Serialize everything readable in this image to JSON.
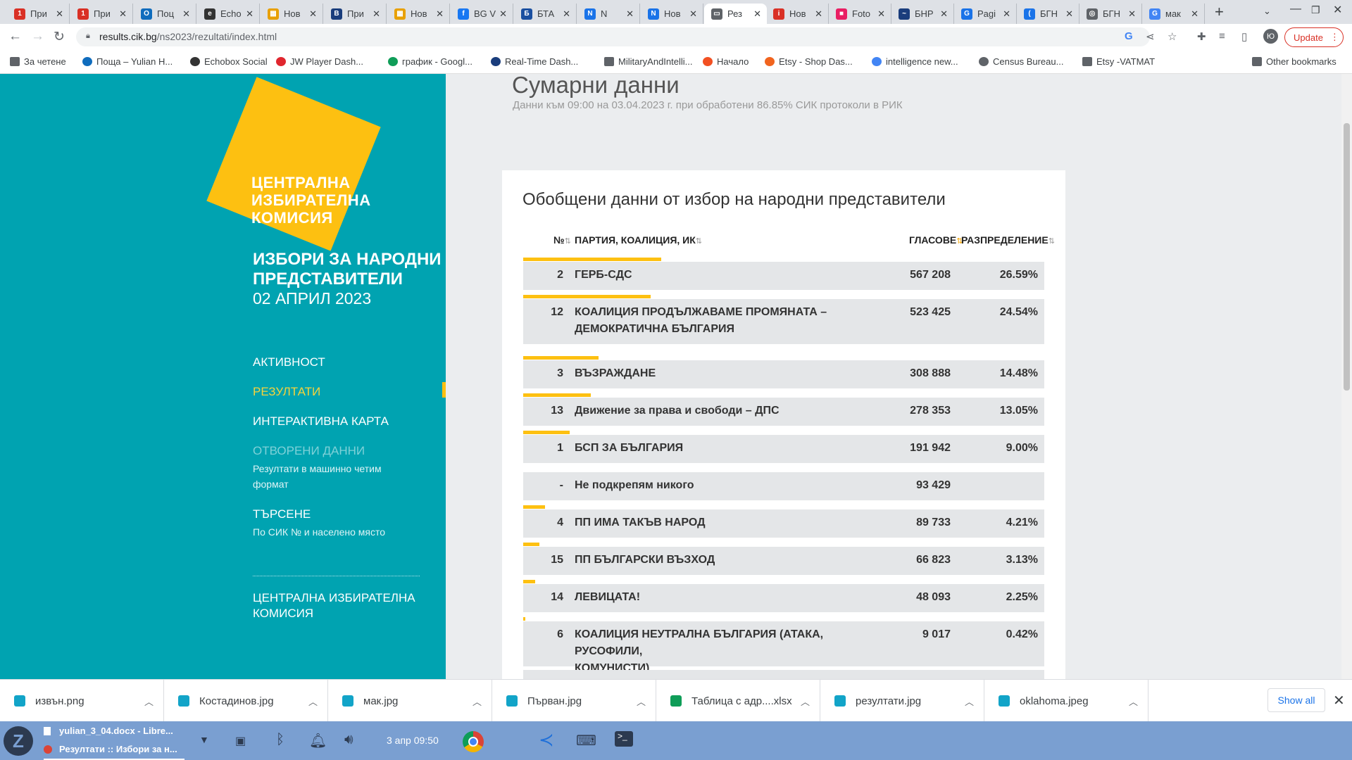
{
  "browser": {
    "tabs": [
      {
        "label": "При",
        "fav_color": "#d93025",
        "fav_char": "1"
      },
      {
        "label": "При",
        "fav_color": "#d93025",
        "fav_char": "1"
      },
      {
        "label": "Поц",
        "fav_color": "#0f6cbd",
        "fav_char": "O"
      },
      {
        "label": "Echo",
        "fav_color": "#333333",
        "fav_char": "e"
      },
      {
        "label": "Нов",
        "fav_color": "#e8a000",
        "fav_char": "▦"
      },
      {
        "label": "При",
        "fav_color": "#1a3d7c",
        "fav_char": "B"
      },
      {
        "label": "Нов",
        "fav_color": "#e8a000",
        "fav_char": "▦"
      },
      {
        "label": "BG V",
        "fav_color": "#1877f2",
        "fav_char": "f"
      },
      {
        "label": "БТА",
        "fav_color": "#1a4fa0",
        "fav_char": "Б"
      },
      {
        "label": "N",
        "fav_color": "#1a73e8",
        "fav_char": "N"
      },
      {
        "label": "Нов",
        "fav_color": "#1a73e8",
        "fav_char": "N"
      },
      {
        "label": "Рез",
        "fav_color": "#5f6368",
        "fav_char": "▭"
      },
      {
        "label": "Нов",
        "fav_color": "#d93025",
        "fav_char": "i"
      },
      {
        "label": "Foto",
        "fav_color": "#e91e63",
        "fav_char": "■"
      },
      {
        "label": "БНР",
        "fav_color": "#1a3d7c",
        "fav_char": "~"
      },
      {
        "label": "Pagi",
        "fav_color": "#1a73e8",
        "fav_char": "G"
      },
      {
        "label": "БГН",
        "fav_color": "#1a73e8",
        "fav_char": "("
      },
      {
        "label": "БГН",
        "fav_color": "#5f6368",
        "fav_char": "◎"
      },
      {
        "label": "мак",
        "fav_color": "#4285f4",
        "fav_char": "G"
      }
    ],
    "url_host": "results.cik.bg",
    "url_path": "/ns2023/rezultati/index.html",
    "update_label": "Update",
    "profile_initial": "Ю",
    "bookmarks": [
      {
        "label": "За четене",
        "icon": "folder-icon"
      },
      {
        "label": "Поща – Yulian H...",
        "icon": "outlook-icon"
      },
      {
        "label": "Echobox Social",
        "icon": "echobox-icon"
      },
      {
        "label": "JW Player Dash...",
        "icon": "jwplayer-icon"
      },
      {
        "label": "график - Googl...",
        "icon": "sheets-icon"
      },
      {
        "label": "Real-Time Dash...",
        "icon": "dashboard-icon"
      },
      {
        "label": "MilitaryAndIntelli...",
        "icon": "folder-icon"
      },
      {
        "label": "Начало",
        "icon": "windows-icon"
      },
      {
        "label": "Etsy - Shop Das...",
        "icon": "etsy-icon"
      },
      {
        "label": "intelligence new...",
        "icon": "google-icon"
      },
      {
        "label": "Census Bureau...",
        "icon": "globe-icon"
      },
      {
        "label": "Etsy -VATMAT",
        "icon": "folder-icon"
      },
      {
        "label": "Other bookmarks",
        "icon": "folder-icon"
      }
    ]
  },
  "sidebar": {
    "logo_text": [
      "ЦЕНТРАЛНА",
      "ИЗБИРАТЕЛНА",
      "КОМИСИЯ"
    ],
    "election_title": [
      "ИЗБОРИ ЗА НАРОДНИ",
      "ПРЕДСТАВИТЕЛИ"
    ],
    "election_date": "02 АПРИЛ 2023",
    "menu": {
      "activity": "АКТИВНОСТ",
      "results": "РЕЗУЛТАТИ",
      "map": "ИНТЕРАКТИВНА КАРТА",
      "open_data": "ОТВОРЕНИ ДАННИ",
      "open_data_sub": [
        "Резултати в машинно четим",
        "формат"
      ],
      "search": "ТЪРСЕНЕ",
      "search_sub": "По СИК № и населено място"
    },
    "footer": [
      "ЦЕНТРАЛНА ИЗБИРАТЕЛНА",
      "КОМИСИЯ"
    ]
  },
  "main": {
    "summary_title": "Сумарни данни",
    "summary_subtitle": "Данни към 09:00 на 03.04.2023 г. при обработени 86.85% СИК протоколи в РИК",
    "card_title": "Обобщени данни от избор на народни представители",
    "columns": {
      "num": "№",
      "party": "ПАРТИЯ, КОАЛИЦИЯ, ИК",
      "votes": "ГЛАСОВЕ",
      "share": "РАЗПРЕДЕЛЕНИЕ"
    },
    "rows": [
      {
        "num": "2",
        "party": [
          "ГЕРБ-СДС"
        ],
        "votes": "567 208",
        "share": "26.59%",
        "share_value": 26.59
      },
      {
        "num": "12",
        "party": [
          "КОАЛИЦИЯ ПРОДЪЛЖАВАМЕ ПРОМЯНАТА –",
          "ДЕМОКРАТИЧНА БЪЛГАРИЯ"
        ],
        "votes": "523 425",
        "share": "24.54%",
        "share_value": 24.54
      },
      {
        "num": "3",
        "party": [
          "ВЪЗРАЖДАНЕ"
        ],
        "votes": "308 888",
        "share": "14.48%",
        "share_value": 14.48
      },
      {
        "num": "13",
        "party": [
          "Движение за права и свободи – ДПС"
        ],
        "votes": "278 353",
        "share": "13.05%",
        "share_value": 13.05
      },
      {
        "num": "1",
        "party": [
          "БСП ЗА БЪЛГАРИЯ"
        ],
        "votes": "191 942",
        "share": "9.00%",
        "share_value": 9.0
      },
      {
        "num": "-",
        "party": [
          "Не подкрепям никого"
        ],
        "votes": "93 429",
        "share": "",
        "share_value": 0
      },
      {
        "num": "4",
        "party": [
          "ПП ИМА ТАКЪВ НАРОД"
        ],
        "votes": "89 733",
        "share": "4.21%",
        "share_value": 4.21
      },
      {
        "num": "15",
        "party": [
          "ПП БЪЛГАРСКИ ВЪЗХОД"
        ],
        "votes": "66 823",
        "share": "3.13%",
        "share_value": 3.13
      },
      {
        "num": "14",
        "party": [
          "ЛЕВИЦАТА!"
        ],
        "votes": "48 093",
        "share": "2.25%",
        "share_value": 2.25
      },
      {
        "num": "6",
        "party": [
          "КОАЛИЦИЯ НЕУТРАЛНА БЪЛГАРИЯ (АТАКА, РУСОФИЛИ,",
          "КОМУНИСТИ)"
        ],
        "votes": "9 017",
        "share": "0.42%",
        "share_value": 0.42
      }
    ]
  },
  "downloads": {
    "items": [
      {
        "label": "извън.png",
        "icon": "image-icon"
      },
      {
        "label": "Костадинов.jpg",
        "icon": "image-icon"
      },
      {
        "label": "мак.jpg",
        "icon": "image-icon"
      },
      {
        "label": "Първан.jpg",
        "icon": "image-icon"
      },
      {
        "label": "Таблица с адр....xlsx",
        "icon": "sheet-icon"
      },
      {
        "label": "резултати.jpg",
        "icon": "image-icon"
      },
      {
        "label": "oklahoma.jpeg",
        "icon": "image-icon"
      }
    ],
    "show_all": "Show all"
  },
  "taskbar": {
    "tasks": [
      "yulian_3_04.docx - Libre...",
      "Резултати :: Избори за н..."
    ],
    "clock": "3 апр 09:50"
  }
}
